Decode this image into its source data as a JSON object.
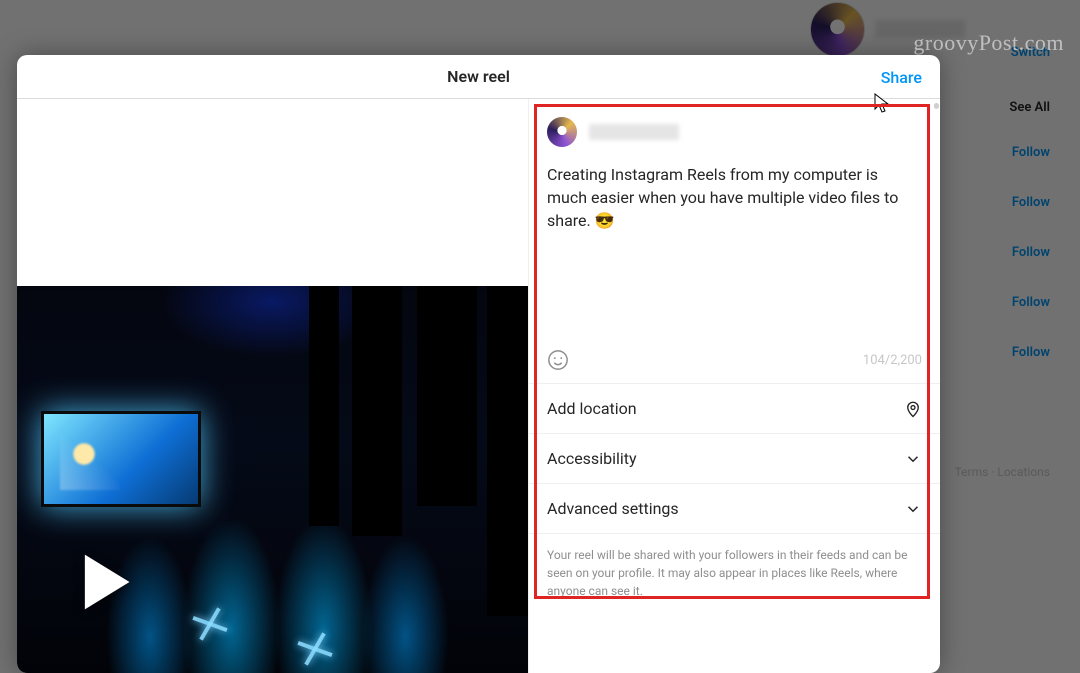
{
  "watermark": "groovyPost.com",
  "modal": {
    "title": "New reel",
    "share_label": "Share"
  },
  "background": {
    "switch_label": "Switch",
    "see_all_label": "See All",
    "follow_label": "Follow",
    "footer_text": "Terms · Locations"
  },
  "compose": {
    "caption_text": "Creating Instagram Reels from my computer is much easier when you have multiple video files to share. 😎",
    "char_counter": "104/2,200"
  },
  "options": {
    "add_location": "Add location",
    "accessibility": "Accessibility",
    "advanced": "Advanced settings"
  },
  "disclaimer": "Your reel will be shared with your followers in their feeds and can be seen on your profile. It may also appear in places like Reels, where anyone can see it."
}
